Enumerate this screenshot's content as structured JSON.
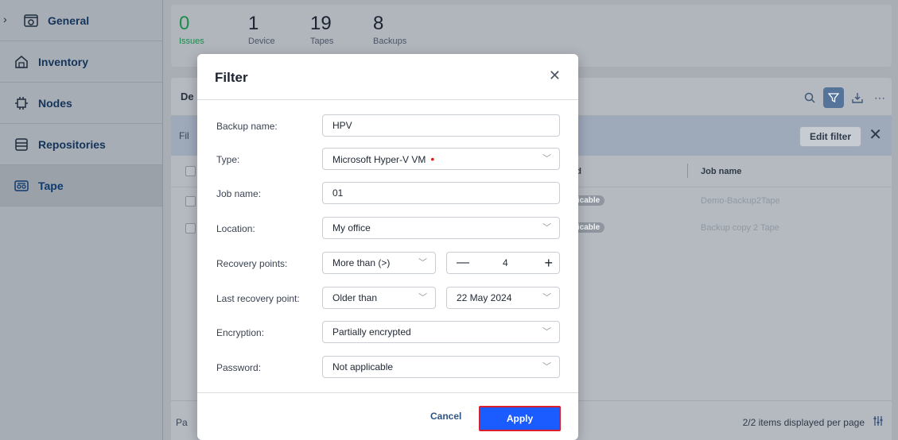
{
  "sidebar": {
    "items": [
      {
        "label": "General",
        "icon": "gear-box-icon"
      },
      {
        "label": "Inventory",
        "icon": "inventory-icon"
      },
      {
        "label": "Nodes",
        "icon": "nodes-icon"
      },
      {
        "label": "Repositories",
        "icon": "repository-icon"
      },
      {
        "label": "Tape",
        "icon": "tape-icon"
      }
    ]
  },
  "stats": [
    {
      "value": "0",
      "label": "Issues"
    },
    {
      "value": "1",
      "label": "Device"
    },
    {
      "value": "19",
      "label": "Tapes"
    },
    {
      "value": "8",
      "label": "Backups"
    }
  ],
  "panel": {
    "title_fragment": "De",
    "filterbar_fragment": "Fil",
    "edit_filter": "Edit filter",
    "columns": {
      "password_fragment": "rd",
      "job_name": "Job name"
    },
    "rows": [
      {
        "badge": "plicable",
        "job": "Demo-Backup2Tape"
      },
      {
        "badge": "plicable",
        "job": "Backup copy 2 Tape"
      }
    ],
    "footer_fragment": "Pa",
    "items_text": "2/2 items displayed per page"
  },
  "modal": {
    "title": "Filter",
    "fields": {
      "backup_name": {
        "label": "Backup name:",
        "value": "HPV"
      },
      "type": {
        "label": "Type:",
        "value": "Microsoft Hyper-V VM"
      },
      "job_name": {
        "label": "Job name:",
        "value": "01"
      },
      "location": {
        "label": "Location:",
        "value": "My office"
      },
      "recovery_points": {
        "label": "Recovery points:",
        "operator": "More than (>)",
        "count": "4"
      },
      "last_recovery_point": {
        "label": "Last recovery point:",
        "operator": "Older than",
        "date": "22 May 2024"
      },
      "encryption": {
        "label": "Encryption:",
        "value": "Partially encrypted"
      },
      "password": {
        "label": "Password:",
        "value": "Not applicable"
      }
    },
    "cancel": "Cancel",
    "apply": "Apply"
  },
  "colors": {
    "accent": "#1a5cff",
    "issues": "#1d8c4c",
    "highlight": "#d8202a"
  }
}
